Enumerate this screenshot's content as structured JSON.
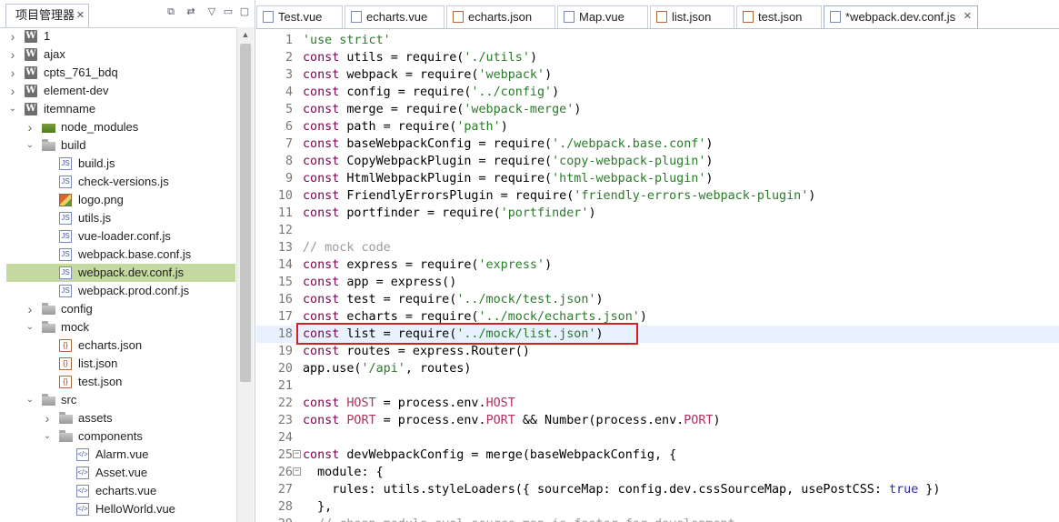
{
  "project_explorer": {
    "tab_title": "项目管理器",
    "tree": [
      {
        "label": "1",
        "depth": 0,
        "arrow": "right",
        "icon": "project-icon"
      },
      {
        "label": "ajax",
        "depth": 0,
        "arrow": "right",
        "icon": "project-icon"
      },
      {
        "label": "cpts_761_bdq",
        "depth": 0,
        "arrow": "right",
        "icon": "project-icon"
      },
      {
        "label": "element-dev",
        "depth": 0,
        "arrow": "right",
        "icon": "project-icon"
      },
      {
        "label": "itemname",
        "depth": 0,
        "arrow": "down",
        "icon": "project-icon"
      },
      {
        "label": "node_modules",
        "depth": 1,
        "arrow": "right",
        "icon": "node-modules-folder-icon"
      },
      {
        "label": "build",
        "depth": 1,
        "arrow": "down",
        "icon": "folder-icon"
      },
      {
        "label": "build.js",
        "depth": 2,
        "arrow": "",
        "icon": "js-file-icon"
      },
      {
        "label": "check-versions.js",
        "depth": 2,
        "arrow": "",
        "icon": "js-file-icon"
      },
      {
        "label": "logo.png",
        "depth": 2,
        "arrow": "",
        "icon": "png-file-icon"
      },
      {
        "label": "utils.js",
        "depth": 2,
        "arrow": "",
        "icon": "js-file-icon"
      },
      {
        "label": "vue-loader.conf.js",
        "depth": 2,
        "arrow": "",
        "icon": "js-file-icon"
      },
      {
        "label": "webpack.base.conf.js",
        "depth": 2,
        "arrow": "",
        "icon": "js-file-icon"
      },
      {
        "label": "webpack.dev.conf.js",
        "depth": 2,
        "arrow": "",
        "icon": "js-file-icon",
        "selected": true
      },
      {
        "label": "webpack.prod.conf.js",
        "depth": 2,
        "arrow": "",
        "icon": "js-file-icon"
      },
      {
        "label": "config",
        "depth": 1,
        "arrow": "right",
        "icon": "folder-icon"
      },
      {
        "label": "mock",
        "depth": 1,
        "arrow": "down",
        "icon": "folder-icon"
      },
      {
        "label": "echarts.json",
        "depth": 2,
        "arrow": "",
        "icon": "json-file-icon"
      },
      {
        "label": "list.json",
        "depth": 2,
        "arrow": "",
        "icon": "json-file-icon"
      },
      {
        "label": "test.json",
        "depth": 2,
        "arrow": "",
        "icon": "json-file-icon"
      },
      {
        "label": "src",
        "depth": 1,
        "arrow": "down",
        "icon": "folder-icon"
      },
      {
        "label": "assets",
        "depth": 2,
        "arrow": "right",
        "icon": "folder-icon"
      },
      {
        "label": "components",
        "depth": 2,
        "arrow": "down",
        "icon": "folder-icon"
      },
      {
        "label": "Alarm.vue",
        "depth": 3,
        "arrow": "",
        "icon": "vue-file-icon"
      },
      {
        "label": "Asset.vue",
        "depth": 3,
        "arrow": "",
        "icon": "vue-file-icon"
      },
      {
        "label": "echarts.vue",
        "depth": 3,
        "arrow": "",
        "icon": "vue-file-icon"
      },
      {
        "label": "HelloWorld.vue",
        "depth": 3,
        "arrow": "",
        "icon": "vue-file-icon"
      }
    ]
  },
  "editor_tabs": [
    {
      "label": "Test.vue",
      "icon": "vue-file-icon",
      "kind": "vue"
    },
    {
      "label": "echarts.vue",
      "icon": "vue-file-icon",
      "kind": "vue"
    },
    {
      "label": "echarts.json",
      "icon": "json-file-icon",
      "kind": "json"
    },
    {
      "label": "Map.vue",
      "icon": "vue-file-icon",
      "kind": "vue"
    },
    {
      "label": "list.json",
      "icon": "json-file-icon",
      "kind": "json"
    },
    {
      "label": "test.json",
      "icon": "json-file-icon",
      "kind": "json"
    },
    {
      "label": "*webpack.dev.conf.js",
      "icon": "js-file-icon",
      "kind": "js",
      "active": true
    }
  ],
  "code_lines": [
    {
      "n": "1",
      "text": "'use strict'"
    },
    {
      "n": "2",
      "text": "const utils = require('./utils')"
    },
    {
      "n": "3",
      "text": "const webpack = require('webpack')"
    },
    {
      "n": "4",
      "text": "const config = require('../config')"
    },
    {
      "n": "5",
      "text": "const merge = require('webpack-merge')"
    },
    {
      "n": "6",
      "text": "const path = require('path')"
    },
    {
      "n": "7",
      "text": "const baseWebpackConfig = require('./webpack.base.conf')"
    },
    {
      "n": "8",
      "text": "const CopyWebpackPlugin = require('copy-webpack-plugin')"
    },
    {
      "n": "9",
      "text": "const HtmlWebpackPlugin = require('html-webpack-plugin')"
    },
    {
      "n": "10",
      "text": "const FriendlyErrorsPlugin = require('friendly-errors-webpack-plugin')"
    },
    {
      "n": "11",
      "text": "const portfinder = require('portfinder')"
    },
    {
      "n": "12",
      "text": ""
    },
    {
      "n": "13",
      "text": "// mock code"
    },
    {
      "n": "14",
      "text": "const express = require('express')"
    },
    {
      "n": "15",
      "text": "const app = express()"
    },
    {
      "n": "16",
      "text": "const test = require('../mock/test.json')"
    },
    {
      "n": "17",
      "text": "const echarts = require('../mock/echarts.json')"
    },
    {
      "n": "18",
      "text": "const list = require('../mock/list.json')",
      "current": true
    },
    {
      "n": "19",
      "text": "const routes = express.Router()"
    },
    {
      "n": "20",
      "text": "app.use('/api', routes)"
    },
    {
      "n": "21",
      "text": ""
    },
    {
      "n": "22",
      "text": "const HOST = process.env.HOST"
    },
    {
      "n": "23",
      "text": "const PORT = process.env.PORT && Number(process.env.PORT)"
    },
    {
      "n": "24",
      "text": ""
    },
    {
      "n": "25",
      "text": "const devWebpackConfig = merge(baseWebpackConfig, {",
      "fold": true
    },
    {
      "n": "26",
      "text": "  module: {",
      "fold": true
    },
    {
      "n": "27",
      "text": "    rules: utils.styleLoaders({ sourceMap: config.dev.cssSourceMap, usePostCSS: true })"
    },
    {
      "n": "28",
      "text": "  },"
    },
    {
      "n": "29",
      "text": "  // cheap-module-eval-source-map is faster for development"
    }
  ],
  "colors": {
    "keyword": "#7f0055",
    "string": "#2a7a2a",
    "comment": "#9a9a9a",
    "selection": "#c4d9a0",
    "current_line": "#e8f2fe",
    "annotation_box": "#d42020"
  }
}
